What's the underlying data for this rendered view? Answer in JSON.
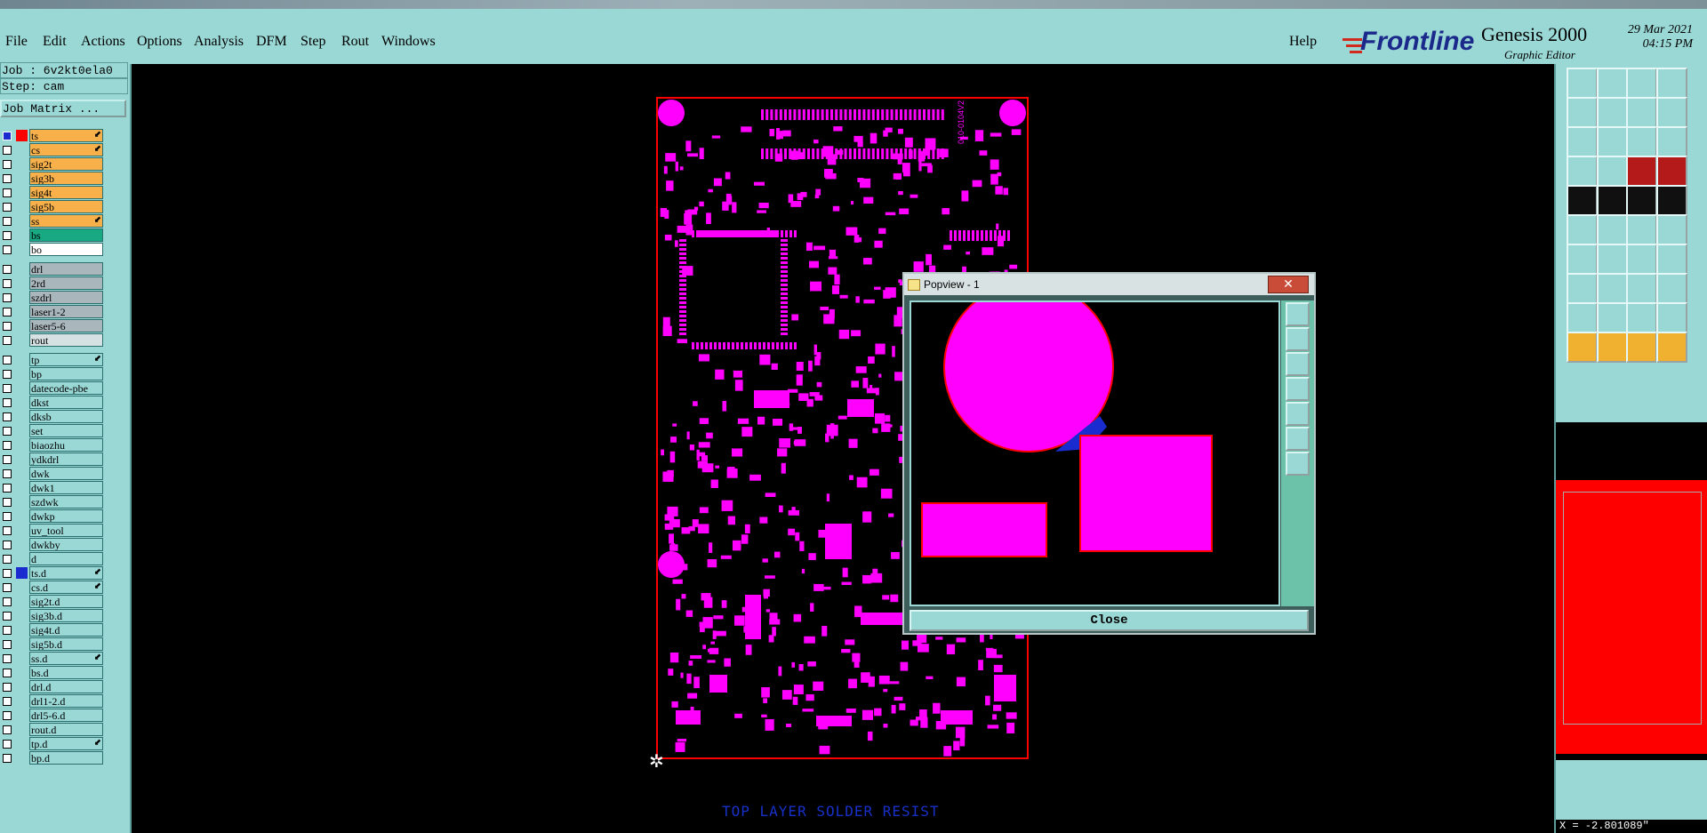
{
  "menubar": {
    "items": [
      "File",
      "Edit",
      "Actions",
      "Options",
      "Analysis",
      "DFM",
      "Step",
      "Rout",
      "Windows"
    ],
    "help": "Help"
  },
  "brand": {
    "logo": "Frontline",
    "product": "Genesis 2000",
    "subtitle": "Graphic Editor",
    "date": "29 Mar 2021",
    "time": "04:15 PM"
  },
  "job": {
    "job_label": "Job : 6v2kt0ela0",
    "step_label": "Step: cam",
    "matrix_button": "Job Matrix ..."
  },
  "layers": {
    "group1": [
      {
        "name": "ts",
        "color": "#f8b04a",
        "swatch": "#ff0000",
        "arrow": "⬋",
        "checked": true
      },
      {
        "name": "cs",
        "color": "#f8b04a",
        "swatch": "",
        "arrow": "⬋",
        "checked": false
      },
      {
        "name": "sig2t",
        "color": "#f8b04a",
        "swatch": "",
        "arrow": "",
        "checked": false
      },
      {
        "name": "sig3b",
        "color": "#f8b04a",
        "swatch": "",
        "arrow": "",
        "checked": false
      },
      {
        "name": "sig4t",
        "color": "#f8b04a",
        "swatch": "",
        "arrow": "",
        "checked": false
      },
      {
        "name": "sig5b",
        "color": "#f8b04a",
        "swatch": "",
        "arrow": "",
        "checked": false
      },
      {
        "name": "ss",
        "color": "#f8b04a",
        "swatch": "",
        "arrow": "⬋",
        "checked": false
      },
      {
        "name": "bs",
        "color": "#18a882",
        "swatch": "",
        "arrow": "",
        "checked": false
      },
      {
        "name": "bo",
        "color": "#ffffff",
        "swatch": "",
        "arrow": "",
        "checked": false
      }
    ],
    "group2": [
      {
        "name": "drl",
        "color": "#a9b7bd",
        "swatch": "",
        "arrow": "",
        "checked": false
      },
      {
        "name": "2rd",
        "color": "#a9b7bd",
        "swatch": "",
        "arrow": "",
        "checked": false
      },
      {
        "name": "szdrl",
        "color": "#a9b7bd",
        "swatch": "",
        "arrow": "",
        "checked": false
      },
      {
        "name": "laser1-2",
        "color": "#a9b7bd",
        "swatch": "",
        "arrow": "",
        "checked": false
      },
      {
        "name": "laser5-6",
        "color": "#a9b7bd",
        "swatch": "",
        "arrow": "",
        "checked": false
      },
      {
        "name": "rout",
        "color": "#d6e1e3",
        "swatch": "",
        "arrow": "",
        "checked": false
      }
    ],
    "group3": [
      {
        "name": "tp",
        "color": "#9ad8d6",
        "swatch": "",
        "arrow": "⬋",
        "checked": false
      },
      {
        "name": "bp",
        "color": "#9ad8d6",
        "swatch": "",
        "arrow": "",
        "checked": false
      },
      {
        "name": "datecode-pbe",
        "color": "#9ad8d6",
        "swatch": "",
        "arrow": "",
        "checked": false
      },
      {
        "name": "dkst",
        "color": "#9ad8d6",
        "swatch": "",
        "arrow": "",
        "checked": false
      },
      {
        "name": "dksb",
        "color": "#9ad8d6",
        "swatch": "",
        "arrow": "",
        "checked": false
      },
      {
        "name": "set",
        "color": "#9ad8d6",
        "swatch": "",
        "arrow": "",
        "checked": false
      },
      {
        "name": "biaozhu",
        "color": "#9ad8d6",
        "swatch": "",
        "arrow": "",
        "checked": false
      },
      {
        "name": "ydkdrl",
        "color": "#9ad8d6",
        "swatch": "",
        "arrow": "",
        "checked": false
      },
      {
        "name": "dwk",
        "color": "#9ad8d6",
        "swatch": "",
        "arrow": "",
        "checked": false
      },
      {
        "name": "dwk1",
        "color": "#9ad8d6",
        "swatch": "",
        "arrow": "",
        "checked": false
      },
      {
        "name": "szdwk",
        "color": "#9ad8d6",
        "swatch": "",
        "arrow": "",
        "checked": false
      },
      {
        "name": "dwkp",
        "color": "#9ad8d6",
        "swatch": "",
        "arrow": "",
        "checked": false
      },
      {
        "name": "uv_tool",
        "color": "#9ad8d6",
        "swatch": "",
        "arrow": "",
        "checked": false
      },
      {
        "name": "dwkby",
        "color": "#9ad8d6",
        "swatch": "",
        "arrow": "",
        "checked": false
      },
      {
        "name": "d",
        "color": "#9ad8d6",
        "swatch": "",
        "arrow": "",
        "checked": false
      },
      {
        "name": "ts.d",
        "color": "#9ad8d6",
        "swatch": "#1a2bd0",
        "arrow": "⬋",
        "checked": false
      },
      {
        "name": "cs.d",
        "color": "#9ad8d6",
        "swatch": "",
        "arrow": "⬋",
        "checked": false
      },
      {
        "name": "sig2t.d",
        "color": "#9ad8d6",
        "swatch": "",
        "arrow": "",
        "checked": false
      },
      {
        "name": "sig3b.d",
        "color": "#9ad8d6",
        "swatch": "",
        "arrow": "",
        "checked": false
      },
      {
        "name": "sig4t.d",
        "color": "#9ad8d6",
        "swatch": "",
        "arrow": "",
        "checked": false
      },
      {
        "name": "sig5b.d",
        "color": "#9ad8d6",
        "swatch": "",
        "arrow": "",
        "checked": false
      },
      {
        "name": "ss.d",
        "color": "#9ad8d6",
        "swatch": "",
        "arrow": "⬋",
        "checked": false
      },
      {
        "name": "bs.d",
        "color": "#9ad8d6",
        "swatch": "",
        "arrow": "",
        "checked": false
      },
      {
        "name": "drl.d",
        "color": "#9ad8d6",
        "swatch": "",
        "arrow": "",
        "checked": false
      },
      {
        "name": "drl1-2.d",
        "color": "#9ad8d6",
        "swatch": "",
        "arrow": "",
        "checked": false
      },
      {
        "name": "drl5-6.d",
        "color": "#9ad8d6",
        "swatch": "",
        "arrow": "",
        "checked": false
      },
      {
        "name": "rout.d",
        "color": "#9ad8d6",
        "swatch": "",
        "arrow": "",
        "checked": false
      },
      {
        "name": "tp.d",
        "color": "#9ad8d6",
        "swatch": "",
        "arrow": "⬋",
        "checked": false
      },
      {
        "name": "bp.d",
        "color": "#9ad8d6",
        "swatch": "",
        "arrow": "",
        "checked": false
      }
    ]
  },
  "canvas": {
    "board_label": "010-0104V2",
    "bottom_label": "TOP LAYER SOLDER RESIST",
    "pad_color": "#ff00ff",
    "outline_color": "#ff0000"
  },
  "popview": {
    "title": "Popview - 1",
    "close_button": "Close",
    "close_x": "✕"
  },
  "status": {
    "coordinate": "X = -2.801089\""
  },
  "colors": {
    "panel": "#9ad8d6",
    "overview_fill": "#ff0000"
  }
}
